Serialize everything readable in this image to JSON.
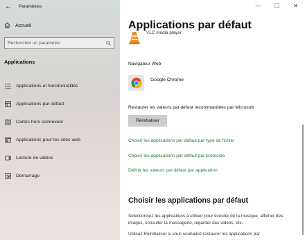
{
  "window": {
    "app_title": "Paramètres",
    "back_icon": "back-arrow-icon",
    "controls": {
      "minimize": "—",
      "maximize": "☐",
      "close": "✕"
    }
  },
  "sidebar": {
    "home_label": "Accueil",
    "search_placeholder": "Rechercher un paramètre",
    "section_title": "Applications",
    "items": [
      {
        "label": "Applications et fonctionnalités",
        "icon": "apps-list-icon"
      },
      {
        "label": "Applications par défaut",
        "icon": "default-apps-icon"
      },
      {
        "label": "Cartes hors connexion",
        "icon": "map-icon"
      },
      {
        "label": "Applications pour les sites web",
        "icon": "website-apps-icon"
      },
      {
        "label": "Lecture de vidéos",
        "icon": "video-icon"
      },
      {
        "label": "Démarrage",
        "icon": "startup-icon"
      }
    ]
  },
  "main": {
    "title": "Applications par défaut",
    "vlc_label": "VLC media player",
    "browser_heading": "Navigateur Web",
    "browser_app": "Google Chrome",
    "restore_text": "Restaurer les valeurs par défaut recommandées par Microsoft",
    "reset_button": "Réinitialiser",
    "links": [
      "Choisir les applications par défaut par type de fichier",
      "Choisir les applications par défaut par protocole",
      "Définir les valeurs par défaut par application"
    ],
    "sub_title": "Choisir les applications par défaut",
    "description": "Sélectionnez les applications à utiliser pour écouter de la musique, afficher des images, consulter la messagerie, regarder des vidéos, etc.",
    "description2": "Utilisez Réinitialiser si vous souhaitez restaurer les applications par"
  },
  "colors": {
    "link": "#217a3a",
    "button": "#cccccc"
  }
}
